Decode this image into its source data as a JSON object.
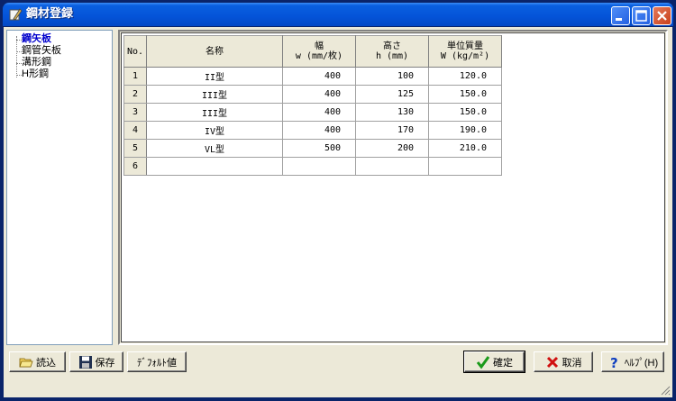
{
  "window": {
    "title": "鋼材登録"
  },
  "tree": {
    "items": [
      {
        "label": "鋼矢板",
        "selected": true
      },
      {
        "label": "鋼管矢板",
        "selected": false
      },
      {
        "label": "溝形鋼",
        "selected": false
      },
      {
        "label": "H形鋼",
        "selected": false
      }
    ]
  },
  "grid": {
    "headers": {
      "no": "No.",
      "name": "名称",
      "width_l1": "幅",
      "width_l2": "w (mm/枚)",
      "height_l1": "高さ",
      "height_l2": "h (mm)",
      "mass_l1": "単位質量",
      "mass_l2": "W (kg/m²)"
    },
    "rows": [
      {
        "no": "1",
        "name": "II型",
        "w": "400",
        "h": "100",
        "mass": "120.0"
      },
      {
        "no": "2",
        "name": "III型",
        "w": "400",
        "h": "125",
        "mass": "150.0"
      },
      {
        "no": "3",
        "name": "III型",
        "w": "400",
        "h": "130",
        "mass": "150.0"
      },
      {
        "no": "4",
        "name": "IV型",
        "w": "400",
        "h": "170",
        "mass": "190.0"
      },
      {
        "no": "5",
        "name": "VL型",
        "w": "500",
        "h": "200",
        "mass": "210.0"
      },
      {
        "no": "6",
        "name": "",
        "w": "",
        "h": "",
        "mass": ""
      }
    ]
  },
  "buttons": {
    "load": "読込",
    "save": "保存",
    "default_values": "ﾃﾞﾌｫﾙﾄ値",
    "ok": "確定",
    "cancel": "取消",
    "help": "ﾍﾙﾌﾟ(H)"
  },
  "icons": {
    "load": "open-folder-icon",
    "save": "floppy-disk-icon",
    "ok": "check-mark-icon",
    "cancel": "red-x-icon",
    "help": "question-mark-icon"
  }
}
